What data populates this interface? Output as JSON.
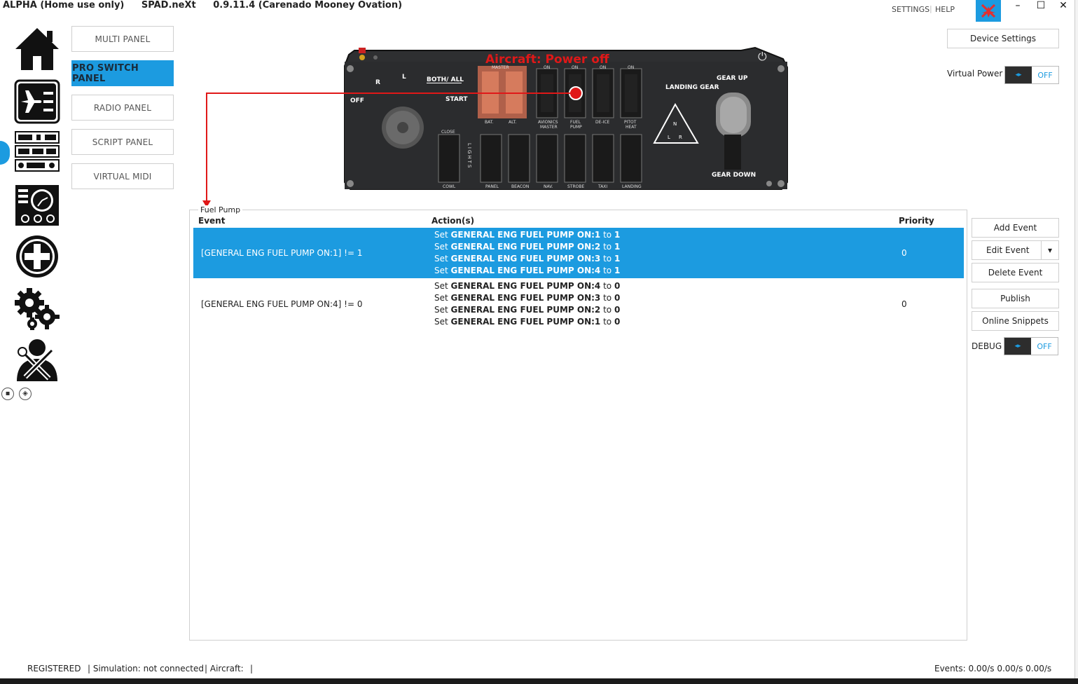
{
  "app": {
    "edition": "ALPHA (Home use only)",
    "name": "SPAD.neXt",
    "version": "0.9.11.4 (Carenado Mooney Ovation)"
  },
  "topnav": {
    "settings": "SETTINGS",
    "help": "HELP"
  },
  "window_controls": {
    "minimize": "–",
    "maximize": "☐",
    "close": "✕"
  },
  "panels": [
    {
      "label": "MULTI PANEL",
      "active": false
    },
    {
      "label": "PRO SWITCH PANEL",
      "active": true
    },
    {
      "label": "RADIO PANEL",
      "active": false
    },
    {
      "label": "SCRIPT PANEL",
      "active": false
    },
    {
      "label": "VIRTUAL MIDI",
      "active": false
    }
  ],
  "device": {
    "overlay_text": "Aircraft: Power off",
    "labels": {
      "off": "OFF",
      "r": "R",
      "l": "L",
      "both": "BOTH/ ALL",
      "start": "START",
      "master": "MASTER",
      "bat": "BAT.",
      "alt": "ALT.",
      "avionics": "AVIONICS",
      "avionics2": "MASTER",
      "fuel": "FUEL",
      "pump": "PUMP",
      "deice": "DE-ICE",
      "pitot": "PITOT",
      "heat": "HEAT",
      "on": "ON",
      "close": "CLOSE",
      "cowl": "COWL",
      "lights": "LIGHTS",
      "panel": "PANEL",
      "beacon": "BEACON",
      "nav": "NAV.",
      "strobe": "STROBE",
      "taxi": "TAXI",
      "landing": "LANDING",
      "landing_gear": "LANDING GEAR",
      "gear_up": "GEAR UP",
      "gear_down": "GEAR DOWN",
      "n": "N",
      "gl": "L",
      "gr": "R"
    }
  },
  "right": {
    "device_settings": "Device Settings",
    "virtual_power_label": "Virtual Power",
    "virtual_power_value": "OFF",
    "toggle_arrows": "◂▸",
    "add_event": "Add Event",
    "edit_event": "Edit Event",
    "dropdown": "▾",
    "delete_event": "Delete Event",
    "publish": "Publish",
    "online_snippets": "Online Snippets",
    "debug_label": "DEBUG",
    "debug_value": "OFF"
  },
  "events": {
    "group": "Fuel Pump",
    "columns": {
      "event": "Event",
      "actions": "Action(s)",
      "priority": "Priority"
    },
    "rows": [
      {
        "event": "[GENERAL ENG FUEL PUMP ON:1] != 1",
        "priority": "0",
        "actions": [
          {
            "verb": "Set",
            "target": "GENERAL ENG FUEL PUMP ON:1",
            "to": "to",
            "value": "1"
          },
          {
            "verb": "Set",
            "target": "GENERAL ENG FUEL PUMP ON:2",
            "to": "to",
            "value": "1"
          },
          {
            "verb": "Set",
            "target": "GENERAL ENG FUEL PUMP ON:3",
            "to": "to",
            "value": "1"
          },
          {
            "verb": "Set",
            "target": "GENERAL ENG FUEL PUMP ON:4",
            "to": "to",
            "value": "1"
          }
        ]
      },
      {
        "event": "[GENERAL ENG FUEL PUMP ON:4] != 0",
        "priority": "0",
        "actions": [
          {
            "verb": "Set",
            "target": "GENERAL ENG FUEL PUMP ON:4",
            "to": "to",
            "value": "0"
          },
          {
            "verb": "Set",
            "target": "GENERAL ENG FUEL PUMP ON:3",
            "to": "to",
            "value": "0"
          },
          {
            "verb": "Set",
            "target": "GENERAL ENG FUEL PUMP ON:2",
            "to": "to",
            "value": "0"
          },
          {
            "verb": "Set",
            "target": "GENERAL ENG FUEL PUMP ON:1",
            "to": "to",
            "value": "0"
          }
        ]
      }
    ]
  },
  "status": {
    "registered": "REGISTERED",
    "simulation": "| Simulation: not connected",
    "aircraft": "| Aircraft:",
    "trail": "|",
    "events_rate": "Events: 0.00/s 0.00/s 0.00/s"
  },
  "colors": {
    "accent": "#1c9be0",
    "device_body": "#2e2f31",
    "overlay": "#e01818"
  }
}
